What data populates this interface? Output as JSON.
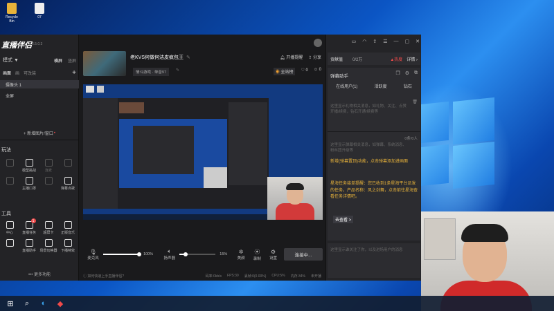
{
  "desktop": {
    "icons": [
      {
        "label": "Recycle Bin",
        "color": "#e8b33a"
      },
      {
        "label": "07",
        "color": "#e8e8e8"
      }
    ]
  },
  "app": {
    "logo": "直播伴侣",
    "version": "6.5.0.3",
    "mode_label": "模式 ▼",
    "mode_tabs": [
      "横屏",
      "竖屏"
    ],
    "scene_label": "画面",
    "scene_tabs": [
      "画",
      "可改装"
    ],
    "add": "+",
    "sources": [
      "摄像头 1",
      "全屏"
    ],
    "add_window_label": "+ 新增图片/窗口",
    "play_section": "玩法",
    "play_items": [
      {
        "label": "",
        "dim": true,
        "icon": "shield-icon"
      },
      {
        "label": "模型挑战",
        "dim": false,
        "icon": "shield-icon"
      },
      {
        "label": "连麦",
        "dim": true,
        "icon": "mic-icon"
      },
      {
        "label": "",
        "dim": true,
        "icon": "gift-icon"
      },
      {
        "label": "",
        "dim": true,
        "icon": "grid-icon"
      },
      {
        "label": "主播口罩",
        "dim": false,
        "icon": "mask-icon"
      },
      {
        "label": "",
        "dim": true,
        "icon": "star-icon"
      },
      {
        "label": "弹幕点歌",
        "dim": false,
        "icon": "music-icon"
      }
    ],
    "tools_section": "工具",
    "tool_items": [
      {
        "label": "中心",
        "icon": "home-icon"
      },
      {
        "label": "直播任务",
        "icon": "task-icon",
        "badge": "1"
      },
      {
        "label": "超屏卡",
        "icon": "card-icon"
      },
      {
        "label": "正版音乐",
        "icon": "download-icon"
      },
      {
        "label": "",
        "icon": "cart-icon"
      },
      {
        "label": "直播助手",
        "icon": "cart-icon"
      },
      {
        "label": "场景切换器",
        "icon": "switch-icon"
      },
      {
        "label": "下播特效",
        "icon": "video-icon"
      }
    ],
    "more_label": "••• 更多功能"
  },
  "stream": {
    "title": "老KVS何做何洁皮疯包王",
    "category": "情斗游戏 · 单音97",
    "start_reminder": "开播提醒",
    "share": "分享",
    "full_rank": "全站榜",
    "likes": "0",
    "viewers": "0"
  },
  "controls": {
    "mic_label": "麦克风",
    "mic_level": "100%",
    "speaker_label": "扬声器",
    "speaker_level": "15%",
    "beauty_label": "美颜",
    "record_label": "录制",
    "settings_label": "设置",
    "connect_button": "连接中..."
  },
  "status_bar": {
    "help": "如何快速上手直播伴侣?",
    "bitrate": "码率:0kb/s",
    "fps": "FPS:30",
    "dropped": "丢帧:0(0.00%)",
    "cpu": "CPU:5%",
    "mem": "内存:34%",
    "net": "未开播"
  },
  "right": {
    "contribution": "贡献值",
    "contribution_value": "0/2万",
    "hot": "热度",
    "detail": "详情",
    "barrage_helper": "弹幕助手",
    "tabs": [
      "在线用户(1)",
      "活跃度",
      "钻石"
    ],
    "empty_notice": "这里显示礼物相关消息，如礼物、关注、点赞开播/续费，钻石开通/续费等",
    "count": "0条/0人",
    "notice_gray": "这里显示弹幕相关消息，如弹幕、系统消息、粉丝团升级等",
    "notice_yellow_1": "新增(弹幕置顶)功能，点击弹幕添加进画面",
    "notice_yellow_2": "星海任务接单提醒：您已收到1条星海平台派发的任务，产品名称：风之剑舞，点击前往星海查看任务详情吧。",
    "go_link": "去查看 >",
    "footer_notice": "这里显示谁关注了你，以及进场用户的消息"
  },
  "titlebar": {
    "icons": [
      "chat-icon",
      "headset-icon",
      "share-icon",
      "menu-icon",
      "minimize-icon",
      "maximize-icon",
      "close-icon"
    ]
  },
  "colors": {
    "accent": "#f04a4a",
    "yellow": "#e8b33a",
    "connect_bg": "#3a3a3e"
  }
}
